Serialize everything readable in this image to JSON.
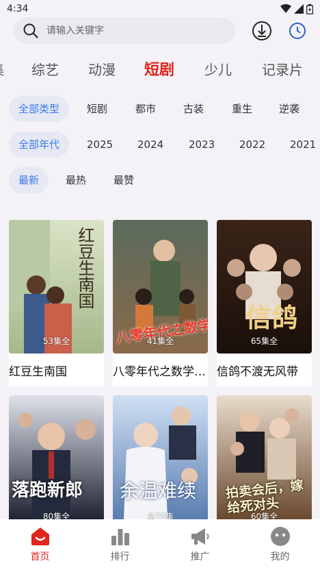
{
  "status": {
    "time": "4:34"
  },
  "search": {
    "placeholder": "请输入关键字"
  },
  "categories": [
    "综艺",
    "动漫",
    "短剧",
    "少儿",
    "记录片"
  ],
  "active_category": "短剧",
  "filters": {
    "type": [
      "全部类型",
      "短剧",
      "都市",
      "古装",
      "重生",
      "逆袭"
    ],
    "year": [
      "全部年代",
      "2025",
      "2024",
      "2023",
      "2022",
      "2021"
    ],
    "sort": [
      "最新",
      "最热",
      "最赞"
    ]
  },
  "shows": [
    {
      "title": "红豆生南国",
      "episodes": "53集全",
      "poster_text": "红豆生南国"
    },
    {
      "title": "八零年代之数学天才",
      "episodes": "41集全",
      "poster_text": "八零年代之数学天才"
    },
    {
      "title": "信鸽不渡无风带",
      "episodes": "65集全",
      "poster_text": "信鸽"
    },
    {
      "title": "落跑新郎",
      "episodes": "80集全",
      "poster_text": "落跑新郎"
    },
    {
      "title": "余温难续",
      "episodes": "全70集",
      "poster_text": "余温难续"
    },
    {
      "title": "拍卖会后，嫁给死对头",
      "episodes": "60集全",
      "poster_text": "拍卖会后，嫁给死对头"
    }
  ],
  "nav": [
    "首页",
    "排行",
    "推广",
    "我的"
  ],
  "colors": {
    "accent": "#e0261d",
    "chip_selected": "#3a7bea"
  }
}
